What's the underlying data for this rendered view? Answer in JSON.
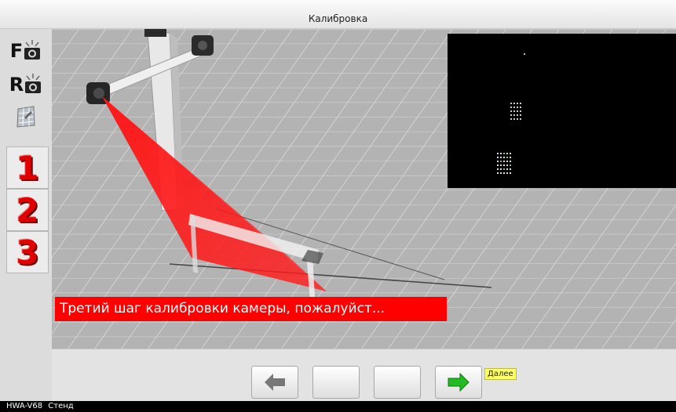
{
  "window": {
    "title": "Калибровка"
  },
  "sidebar": {
    "front_camera_label": "F",
    "rear_camera_label": "R",
    "steps": [
      "1",
      "2",
      "3"
    ]
  },
  "scene": {
    "message": "Третий шаг калибровки камеры, пожалуйст..."
  },
  "navigation": {
    "next_tooltip": "Далее",
    "back_arrow_color": "#777777",
    "next_arrow_color": "#22bb22"
  },
  "status": {
    "model": "HWA-V68",
    "mode": "Стенд"
  }
}
